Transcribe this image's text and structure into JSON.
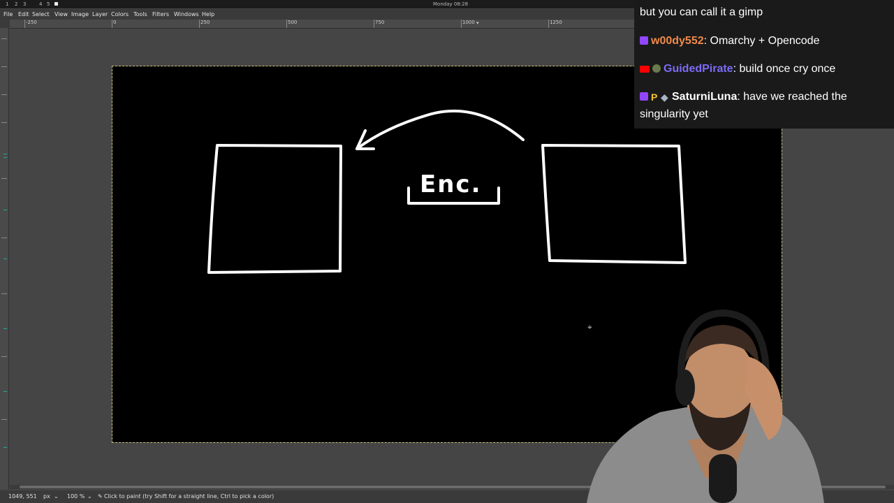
{
  "system_bar": {
    "workspaces": [
      "1",
      "2",
      "3",
      "4",
      "5"
    ],
    "clock": "Monday 08:28"
  },
  "menu": [
    "File",
    "Edit",
    "Select",
    "View",
    "Image",
    "Layer",
    "Colors",
    "Tools",
    "Filters",
    "Windows",
    "Help"
  ],
  "ruler": {
    "labels": [
      "-250",
      "0",
      "250",
      "500",
      "750",
      "1000",
      "1250"
    ]
  },
  "canvas": {
    "annotation_text": "Enc."
  },
  "statusbar": {
    "coords": "1049, 551",
    "unit": "px",
    "zoom": "100 %",
    "hint": "Click to paint (try Shift for a straight line, Ctrl to pick a color)"
  },
  "chat": {
    "messages": [
      {
        "user": "",
        "text": "but you can call it a gimp",
        "platform": "",
        "user_color": "#ffffff"
      },
      {
        "user": "w00dy552",
        "text": ": Omarchy + Opencode",
        "platform": "twitch",
        "user_color": "#f08a4b"
      },
      {
        "user": "GuidedPirate",
        "text": ": build once cry once",
        "platform": "youtube",
        "user_color": "#7b6cf6"
      },
      {
        "user": "SaturniLuna",
        "text": ": have we reached the",
        "text2": "singularity yet",
        "platform": "twitch",
        "user_color": "#ffffff"
      }
    ]
  },
  "colors": {
    "twitch": "#9146ff",
    "youtube": "#ff0000",
    "canvas_bg": "#000000",
    "stroke": "#ffffff"
  }
}
